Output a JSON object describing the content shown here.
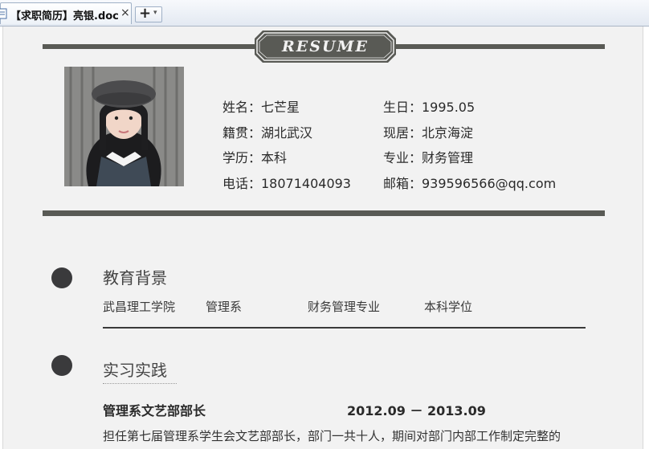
{
  "tab": {
    "title": "【求职简历】亮银.doc",
    "close_glyph": "×",
    "new_tab_glyph": "+",
    "new_tab_menu_glyph": "▾"
  },
  "resume": {
    "banner": "RESUME",
    "info": {
      "name": "姓名：七芒星",
      "birthday": "生日：1995.05",
      "native": "籍贯：湖北武汉",
      "residence": "现居：北京海淀",
      "education": "学历：本科",
      "major": "专业：财务管理",
      "phone": "电话：18071404093",
      "email": "邮箱：939596566@qq.com"
    },
    "education_section": {
      "title": "教育背景",
      "school": "武昌理工学院",
      "department": "管理系",
      "major": "财务管理专业",
      "degree": "本科学位"
    },
    "internship_section": {
      "title": "实习实践",
      "job_title": "管理系文艺部部长",
      "job_period": "2012.09 － 2013.09",
      "job_description": "担任第七届管理系学生会文艺部部长，部门一共十人，期间对部门内部工作制定完整的"
    }
  },
  "colors": {
    "page_background": "#f2f2f2",
    "bar_color": "#595a55",
    "dot_color": "#3a3a3c"
  }
}
